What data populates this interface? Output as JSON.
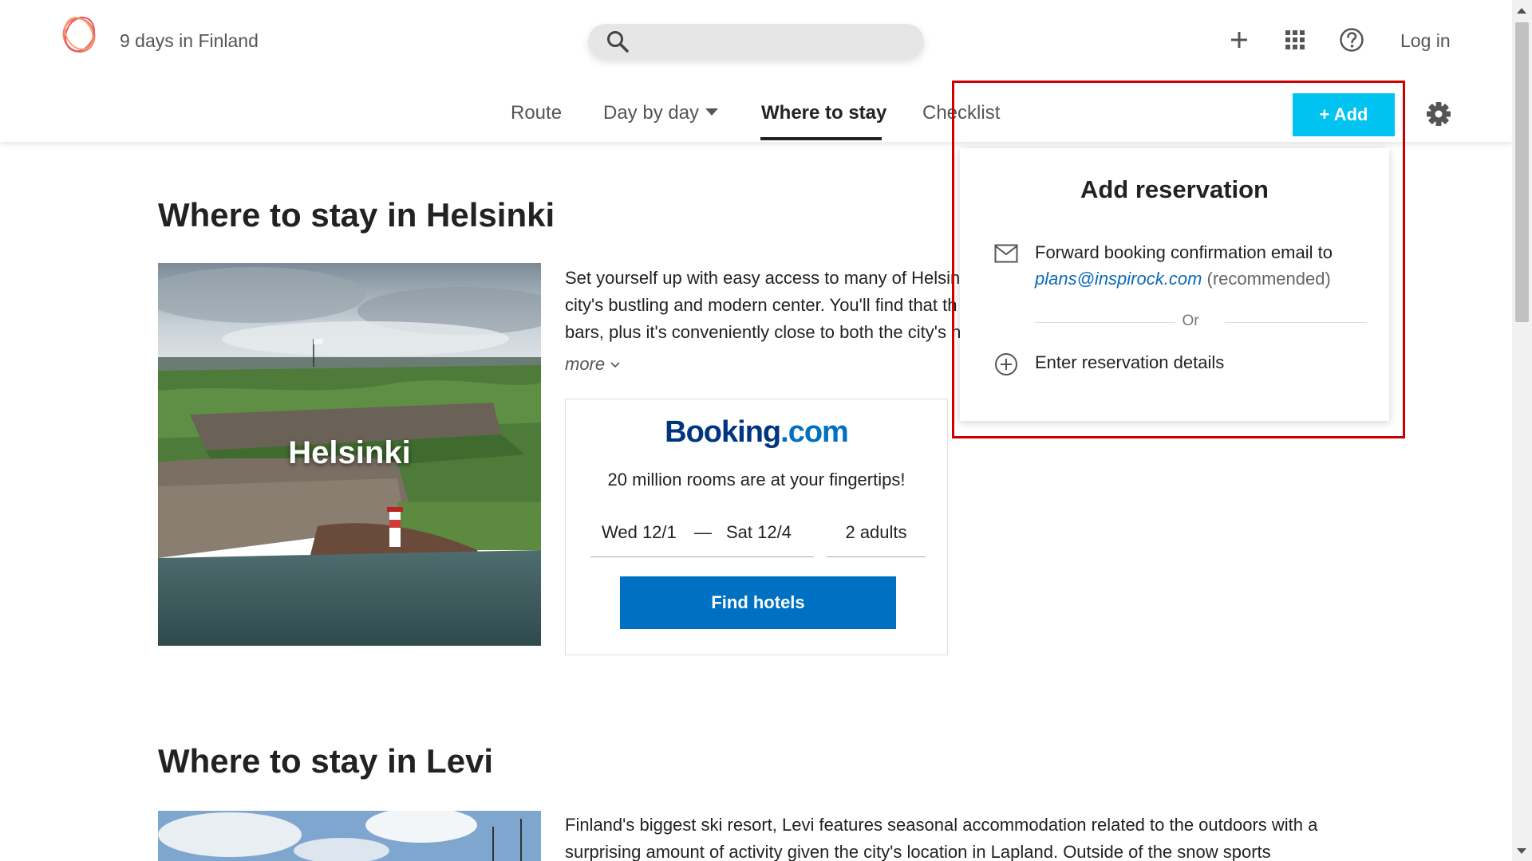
{
  "header": {
    "trip_title": "9 days in Finland",
    "login_label": "Log in"
  },
  "tabs": {
    "route": "Route",
    "day_by_day": "Day by day",
    "where_to_stay": "Where to stay",
    "checklist": "Checklist",
    "active": "where_to_stay"
  },
  "toolbar": {
    "add_label": "+ Add"
  },
  "helsinki": {
    "title": "Where to stay in Helsinki",
    "image_label": "Helsinki",
    "desc_lines": [
      "Set yourself up with easy access to many of Helsink",
      "city's bustling and modern center. You'll find that th",
      "bars, plus it's conveniently close to both the city's h"
    ],
    "more_label": "more"
  },
  "booking": {
    "logo_main": "Booking",
    "logo_tld": ".com",
    "tagline": "20 million rooms are at your fingertips!",
    "check_in": "Wed 12/1",
    "date_separator": "—",
    "check_out": "Sat 12/4",
    "guests": "2 adults",
    "find_label": "Find hotels"
  },
  "levi": {
    "title": "Where to stay in Levi",
    "desc_lines": [
      "Finland's biggest ski resort, Levi features seasonal accommodation related to the outdoors with a",
      "surprising amount of activity given the city's location in Lapland. Outside of the snow sports"
    ]
  },
  "popup": {
    "title": "Add reservation",
    "forward_text": "Forward booking confirmation email to",
    "email": "plans@inspirock.com",
    "recommended": " (recommended)",
    "or_label": "Or",
    "enter_label": "Enter reservation details"
  },
  "colors": {
    "accent": "#00c3f2",
    "booking_blue": "#0071c2",
    "booking_navy": "#003580",
    "highlight_red": "#cc0000",
    "link": "#0a6ab8"
  },
  "icons": {
    "logo": "inspirock-logo-icon",
    "search": "search-icon",
    "plus": "plus-icon",
    "apps": "grid-icon",
    "help": "help-icon",
    "settings": "gear-icon",
    "mail": "mail-icon",
    "add_circle": "plus-circle-icon"
  }
}
